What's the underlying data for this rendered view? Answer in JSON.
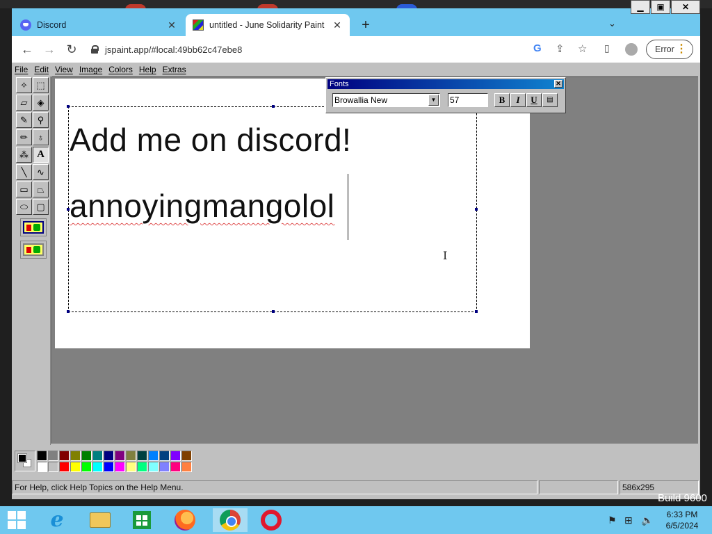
{
  "browser": {
    "tabs": [
      {
        "title": "Discord",
        "favicon": "discord-icon",
        "active": false
      },
      {
        "title": "untitled - June Solidarity Paint",
        "favicon": "paint-icon",
        "active": true
      }
    ],
    "url": "jspaint.app/#local:49bb62c47ebe8",
    "profile_status": "Error",
    "accent": "#6fc8ef"
  },
  "paint": {
    "menus": [
      "File",
      "Edit",
      "View",
      "Image",
      "Colors",
      "Help",
      "Extras"
    ],
    "canvas_text": {
      "line1": "Add me on discord!",
      "line2": "annoyingmangolol"
    },
    "fonts_window": {
      "title": "Fonts",
      "font_name": "Browallia New",
      "font_size": "57",
      "bold": "B",
      "italic": "I",
      "underline": "U"
    },
    "palette": [
      "#000000",
      "#808080",
      "#800000",
      "#808000",
      "#008000",
      "#008080",
      "#000080",
      "#800080",
      "#808040",
      "#004040",
      "#0080ff",
      "#004080",
      "#8000ff",
      "#804000",
      "#ffffff",
      "#c0c0c0",
      "#ff0000",
      "#ffff00",
      "#00ff00",
      "#00ffff",
      "#0000ff",
      "#ff00ff",
      "#ffff80",
      "#00ff80",
      "#80ffff",
      "#8080ff",
      "#ff0080",
      "#ff8040"
    ],
    "current_colors": {
      "foreground": "#000000",
      "background": "#ffffff"
    },
    "status": {
      "help": "For Help, click Help Topics on the Help Menu.",
      "dimensions": "586x295"
    }
  },
  "taskbar": {
    "time": "6:33 PM",
    "date": "6/5/2024",
    "build_text": "Build 9600"
  }
}
